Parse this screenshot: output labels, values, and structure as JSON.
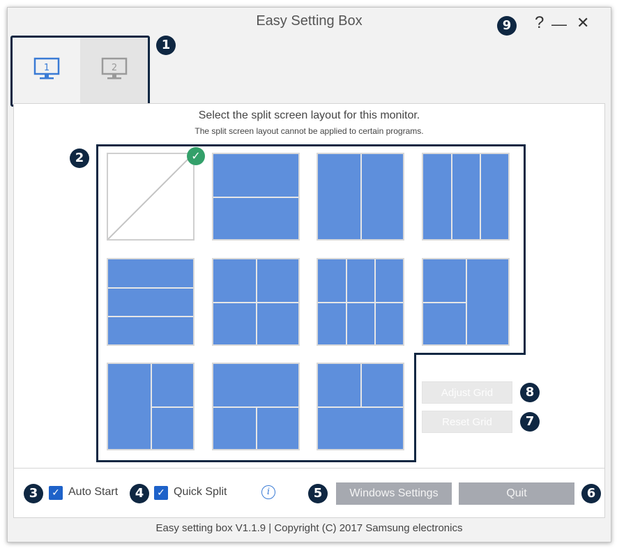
{
  "window": {
    "title": "Easy Setting Box",
    "help_glyph": "?",
    "minimize_glyph": "—",
    "close_glyph": "✕"
  },
  "monitor_tabs": [
    {
      "label": "1",
      "state": "active",
      "icon": "monitor-icon"
    },
    {
      "label": "2",
      "state": "inactive",
      "icon": "monitor-icon"
    }
  ],
  "content": {
    "heading": "Select the split screen layout for this monitor.",
    "subheading": "The split screen layout cannot be applied to certain programs."
  },
  "layouts": [
    {
      "name": "none",
      "selected": true
    },
    {
      "name": "two-rows",
      "selected": false
    },
    {
      "name": "two-columns",
      "selected": false
    },
    {
      "name": "three-columns",
      "selected": false
    },
    {
      "name": "three-rows",
      "selected": false
    },
    {
      "name": "four-quadrants",
      "selected": false
    },
    {
      "name": "six-grid",
      "selected": false
    },
    {
      "name": "left-split-right-full",
      "selected": false
    },
    {
      "name": "left-full-right-split",
      "selected": false
    },
    {
      "name": "top-full-bottom-split",
      "selected": false
    },
    {
      "name": "top-split-bottom-full",
      "selected": false
    }
  ],
  "grid_buttons": {
    "adjust": "Adjust Grid",
    "reset": "Reset Grid"
  },
  "options": {
    "auto_start": {
      "label": "Auto Start",
      "checked": true
    },
    "quick_split": {
      "label": "Quick Split",
      "checked": true
    },
    "check_glyph": "✓",
    "info_glyph": "i"
  },
  "buttons": {
    "windows_settings": "Windows Settings",
    "quit": "Quit"
  },
  "footer": "Easy setting box V1.1.9 | Copyright (C) 2017 Samsung electronics",
  "callouts": [
    "1",
    "2",
    "3",
    "4",
    "5",
    "6",
    "7",
    "8",
    "9"
  ],
  "colors": {
    "accent_blue": "#5e8fdc",
    "callout_navy": "#0f2742",
    "check_green": "#33a06a",
    "checkbox_blue": "#1e62c9"
  }
}
